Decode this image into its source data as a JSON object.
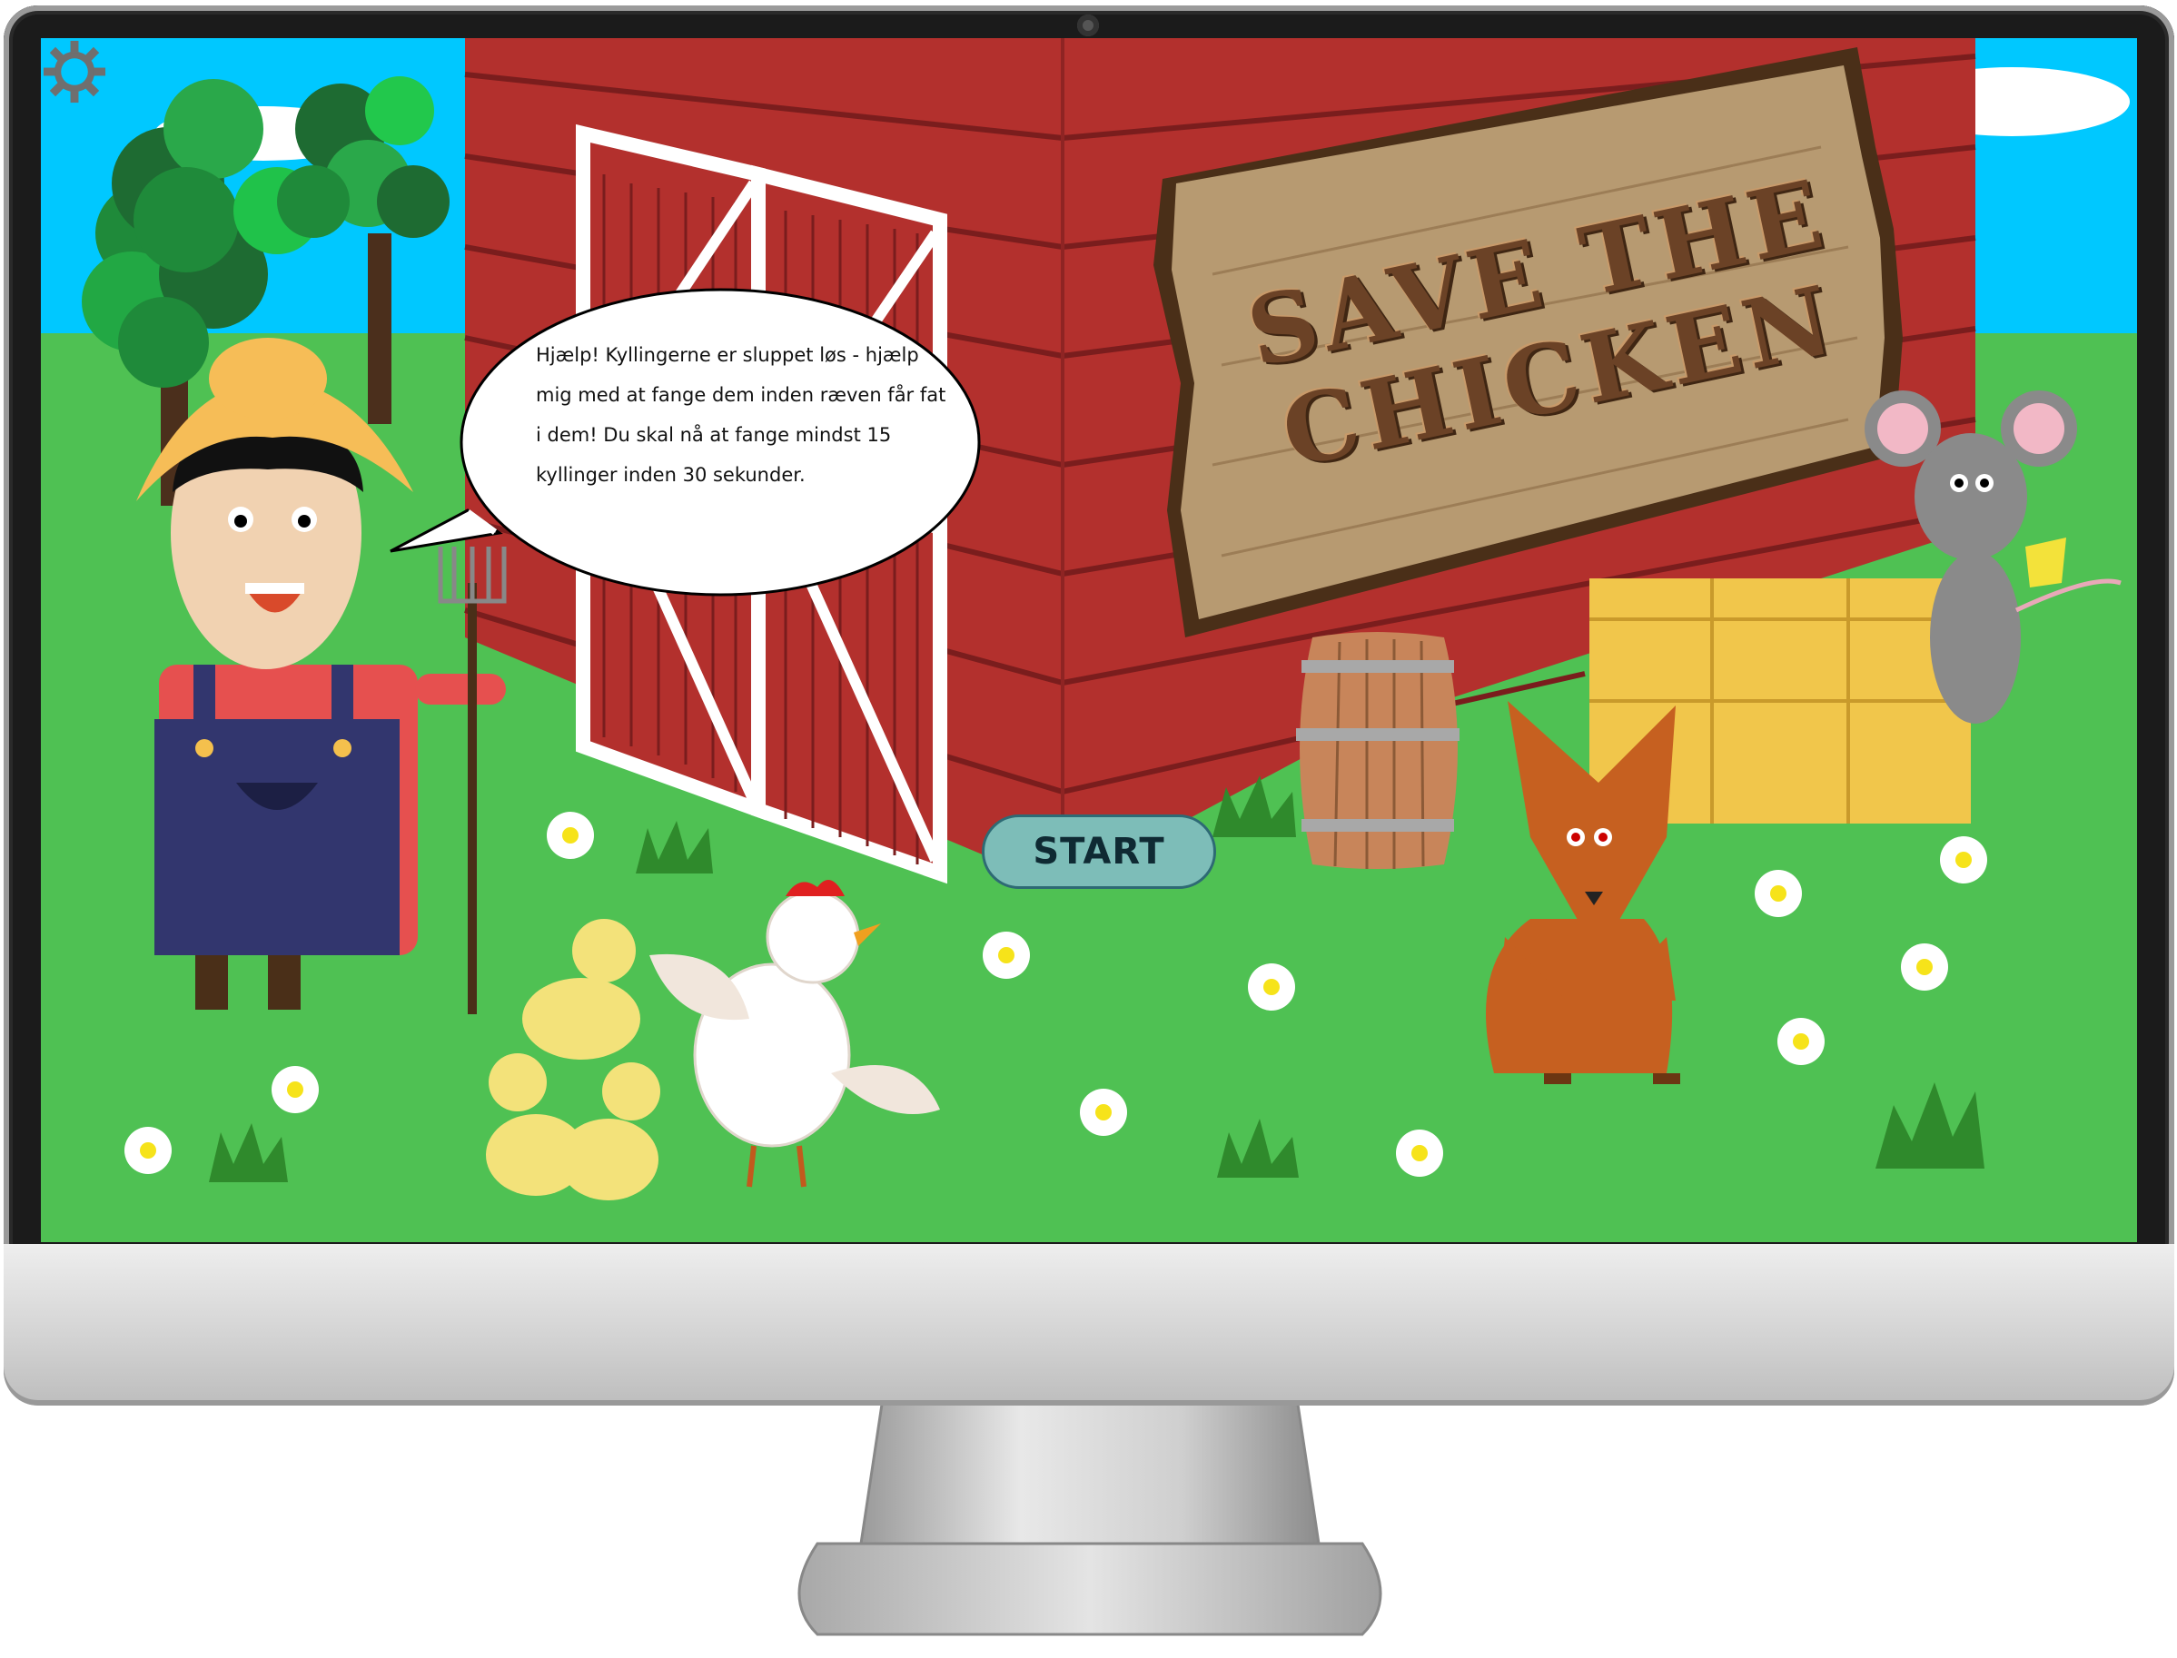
{
  "game": {
    "title": "SAVE THE CHICKEN",
    "title_line1": "SAVE THE",
    "title_line2": "CHICKEN",
    "speech": "Hjælp! Kyllingerne er sluppet løs - hjælp mig med at fange dem inden ræven får fat i dem! Du skal nå at fange mindst 15 kyllinger inden 30 sekunder.",
    "start_label": "START"
  },
  "icons": {
    "settings": "gear-icon"
  },
  "colors": {
    "sky": "#00c8ff",
    "grass": "#4fc153",
    "barn": "#b3302d",
    "sign": "#b79a71",
    "start_button": "#7dbdb8"
  }
}
